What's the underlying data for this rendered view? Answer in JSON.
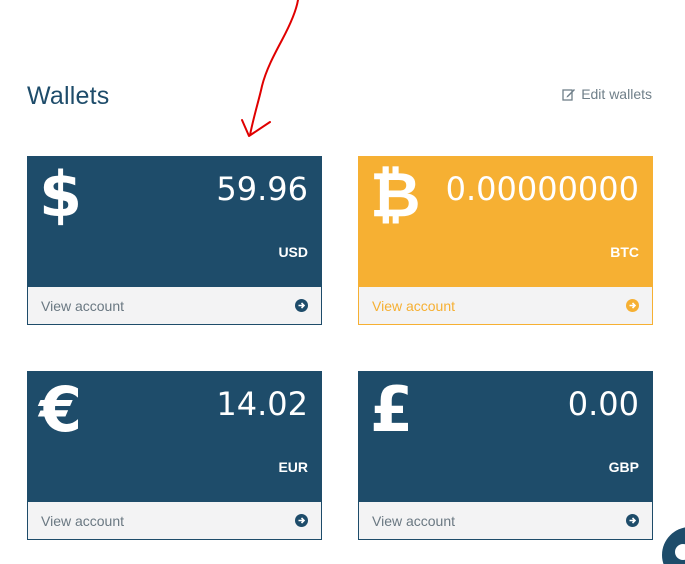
{
  "header": {
    "title": "Wallets",
    "edit_label": "Edit wallets"
  },
  "wallets": [
    {
      "symbol": "$",
      "amount": "59.96",
      "code": "USD",
      "view_label": "View account"
    },
    {
      "symbol": "₿",
      "amount": "0.00000000",
      "code": "BTC",
      "view_label": "View account"
    },
    {
      "symbol": "€",
      "amount": "14.02",
      "code": "EUR",
      "view_label": "View account"
    },
    {
      "symbol": "£",
      "amount": "0.00",
      "code": "GBP",
      "view_label": "View account"
    }
  ],
  "colors": {
    "primary": "#1e4c6a",
    "bitcoin": "#f6b033",
    "annotation": "#e00000"
  },
  "icons": {
    "edit": "edit-icon",
    "arrow": "arrow-circle-right-icon",
    "chat": "chat-widget-icon"
  }
}
